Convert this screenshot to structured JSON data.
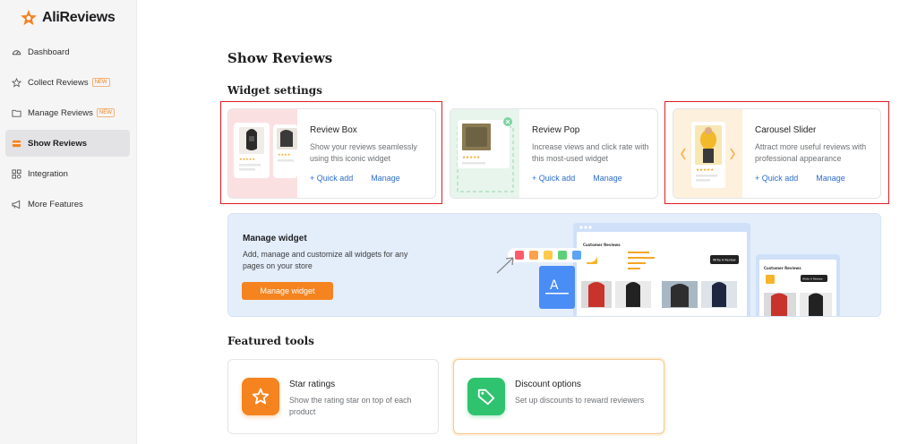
{
  "app": {
    "logo_text": "AliReviews"
  },
  "sidebar": {
    "items": [
      {
        "label": "Dashboard",
        "icon": "dashboard-icon"
      },
      {
        "label": "Collect Reviews",
        "icon": "star-icon",
        "badge": "NEW"
      },
      {
        "label": "Manage Reviews",
        "icon": "folder-icon",
        "badge": "NEW"
      },
      {
        "label": "Show Reviews",
        "icon": "widget-icon",
        "active": true
      },
      {
        "label": "Integration",
        "icon": "integration-icon"
      },
      {
        "label": "More Features",
        "icon": "megaphone-icon"
      }
    ]
  },
  "main": {
    "title": "Show Reviews",
    "widget_settings_title": "Widget settings",
    "widgets": [
      {
        "title": "Review Box",
        "desc": "Show your reviews seamlessly using this iconic widget",
        "quick_add": "+ Quick add",
        "manage": "Manage",
        "highlighted": true
      },
      {
        "title": "Review Pop",
        "desc": "Increase views and click rate with this most-used widget",
        "quick_add": "+ Quick add",
        "manage": "Manage",
        "highlighted": false
      },
      {
        "title": "Carousel Slider",
        "desc": "Attract more useful reviews with professional appearance",
        "quick_add": "+ Quick add",
        "manage": "Manage",
        "highlighted": true
      }
    ],
    "manage_widget": {
      "title": "Manage widget",
      "desc": "Add, manage and customize all widgets for any pages on your store",
      "button": "Manage widget",
      "preview_heading": "Customer Reviews",
      "preview_button": "Write A Review",
      "preview_avg": "4.8"
    },
    "featured_title": "Featured tools",
    "tools": [
      {
        "title": "Star ratings",
        "desc": "Show the rating star on top of each product",
        "icon": "star-outline-icon"
      },
      {
        "title": "Discount options",
        "desc": "Set up discounts to reward reviewers",
        "icon": "tag-icon"
      }
    ]
  },
  "colors": {
    "accent": "#f5831f",
    "link": "#2c6ecb",
    "highlight": "#e01c24",
    "discount_green": "#2fc36f",
    "banner_bg": "#e4eefb",
    "sidebar_bg": "#f5f5f6"
  }
}
